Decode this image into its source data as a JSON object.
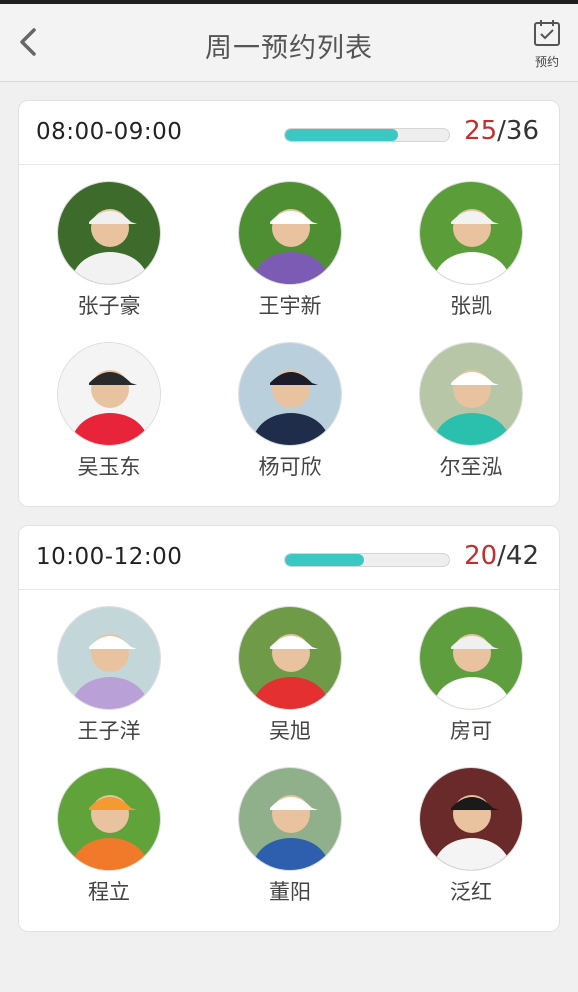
{
  "header": {
    "title": "周一预约列表",
    "book_label": "预约"
  },
  "slots": [
    {
      "time": "08:00-09:00",
      "booked": "25",
      "capacity": "/36",
      "progress_fraction": 0.69,
      "members": [
        {
          "name": "张子豪",
          "bg": "#3d6b2b",
          "shirt": "#f2f2f2",
          "cap": "#f0f0f0"
        },
        {
          "name": "王宇新",
          "bg": "#4f8f33",
          "shirt": "#7c5bb5",
          "cap": "#ffffff"
        },
        {
          "name": "张凯",
          "bg": "#5a9d39",
          "shirt": "#ffffff",
          "cap": "#f2f2f2"
        },
        {
          "name": "吴玉东",
          "bg": "#f4f4f4",
          "shirt": "#e8243a",
          "cap": "#2a2a2a"
        },
        {
          "name": "杨可欣",
          "bg": "#b9d0dc",
          "shirt": "#1f2d4a",
          "cap": "#1c1c2a"
        },
        {
          "name": "尔至泓",
          "bg": "#b6c6a6",
          "shirt": "#2bbfae",
          "cap": "#ffffff"
        }
      ]
    },
    {
      "time": "10:00-12:00",
      "booked": "20",
      "capacity": "/42",
      "progress_fraction": 0.48,
      "members": [
        {
          "name": "王子洋",
          "bg": "#c3d6d9",
          "shirt": "#b9a1d8",
          "cap": "#ffffff"
        },
        {
          "name": "吴旭",
          "bg": "#6f9a48",
          "shirt": "#e43030",
          "cap": "#ffffff"
        },
        {
          "name": "房可",
          "bg": "#5f9e3e",
          "shirt": "#ffffff",
          "cap": "#f0f0f0"
        },
        {
          "name": "程立",
          "bg": "#5fa33a",
          "shirt": "#f07a2a",
          "cap": "#f39a30"
        },
        {
          "name": "董阳",
          "bg": "#8fb08a",
          "shirt": "#2e5fae",
          "cap": "#ffffff"
        },
        {
          "name": "泛红",
          "bg": "#6b2a2a",
          "shirt": "#f4f4f4",
          "cap": "#1a1a1a"
        }
      ]
    }
  ],
  "colors": {
    "accent": "#3cc8c2",
    "booked_count": "#c0302f"
  }
}
